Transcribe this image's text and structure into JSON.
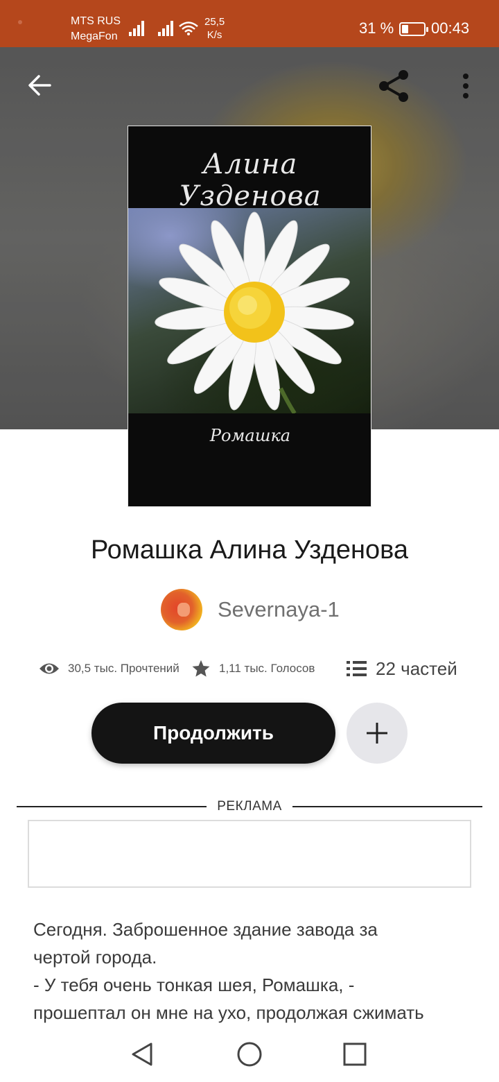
{
  "status_bar": {
    "carrier_1": "MTS RUS",
    "carrier_2": "MegaFon",
    "speed_value": "25,5",
    "speed_unit": "K/s",
    "battery_percent": "31 %",
    "battery_level": 0.31,
    "time": "00:43",
    "background_color": "#b5471c"
  },
  "toolbar": {
    "back_icon": "arrow-left-icon",
    "share_icon": "share-icon",
    "more_icon": "more-vertical-icon"
  },
  "cover": {
    "author_text": "Алина Узденова",
    "title_text": "Ромашка"
  },
  "book": {
    "title": "Ромашка Алина Узденова",
    "author": "Severnaya-1",
    "stats": {
      "reads": "30,5 тыс. Прочтений",
      "votes": "1,11 тыс. Голосов",
      "parts": "22 частей"
    },
    "continue_label": "Продолжить",
    "add_icon": "plus-icon"
  },
  "ad": {
    "label": "РЕКЛАМА"
  },
  "excerpt": {
    "line1": "Сегодня. Заброшенное здание завода за",
    "line2": "чертой города.",
    "line3": "- У тебя очень тонкая шея, Ромашка, -",
    "line4": "прошептал он мне на ухо, продолжая сжимать"
  },
  "nav": {
    "back": "triangle-back-icon",
    "home": "circle-home-icon",
    "recents": "square-recents-icon"
  }
}
